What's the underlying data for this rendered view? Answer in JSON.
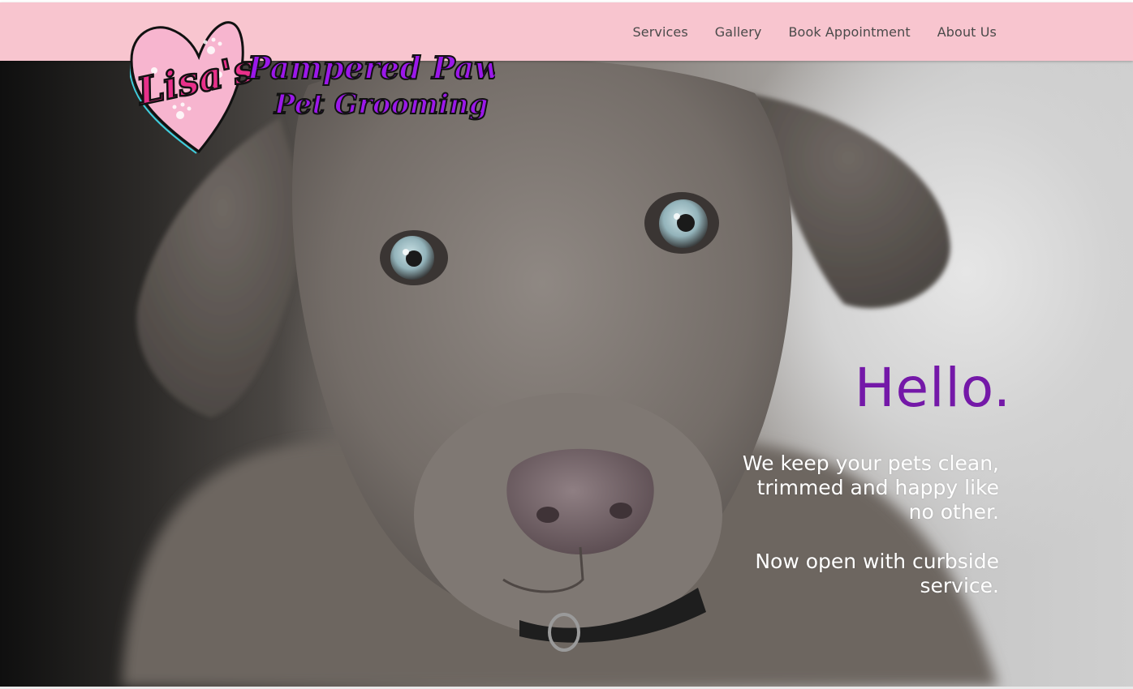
{
  "nav": {
    "items": [
      {
        "label": "Services"
      },
      {
        "label": "Gallery"
      },
      {
        "label": "Book Appointment"
      },
      {
        "label": "About Us"
      }
    ]
  },
  "logo": {
    "line1": "Lisa's",
    "line2": "Pampered Paws",
    "line3": "Pet Grooming"
  },
  "hero": {
    "heading": "Hello.",
    "tagline": "We keep your pets clean, trimmed and happy like no other.",
    "notice": "Now open with curbside service."
  },
  "colors": {
    "header_bg": "#f8c5cf",
    "heading": "#7418a8",
    "logo_purple": "#9b18ea",
    "logo_pink": "#e8308a"
  }
}
